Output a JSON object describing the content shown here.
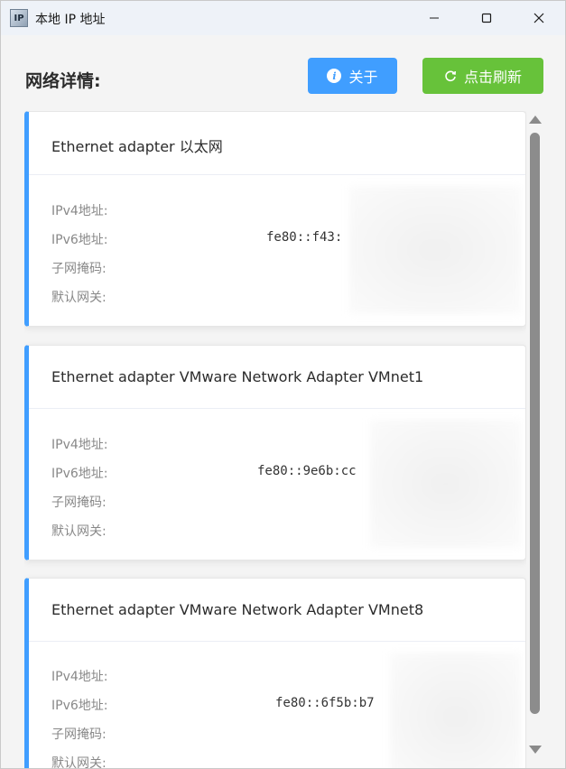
{
  "window": {
    "title": "本地 IP 地址",
    "icon_text": "IP"
  },
  "header": {
    "label": "网络详情:",
    "about_label": "关于",
    "refresh_label": "点击刷新"
  },
  "field_labels": {
    "ipv4": "IPv4地址:",
    "ipv6": "IPv6地址:",
    "mask": "子网掩码:",
    "gateway": "默认网关:"
  },
  "adapters": [
    {
      "name": "Ethernet adapter 以太网",
      "ipv6": "fe80::f43:"
    },
    {
      "name": "Ethernet adapter VMware Network Adapter VMnet1",
      "ipv6": "fe80::9e6b:cc"
    },
    {
      "name": "Ethernet adapter VMware Network Adapter VMnet8",
      "ipv6": "fe80::6f5b:b7"
    }
  ],
  "colors": {
    "about_button": "#409eff",
    "refresh_button": "#67c23a",
    "card_accent": "#409eff"
  },
  "icons": {
    "about": "info-icon",
    "refresh": "refresh-icon",
    "minimize": "minimize-icon",
    "maximize": "maximize-icon",
    "close": "close-icon"
  }
}
